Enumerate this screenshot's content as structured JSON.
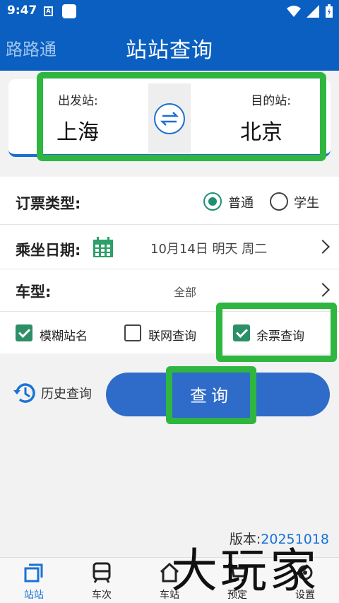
{
  "status_bar": {
    "time": "9:47",
    "notif_icon": "A"
  },
  "app_bar": {
    "app_name": "路路通",
    "title": "站站查询"
  },
  "stations": {
    "from_label": "出发站:",
    "from_value": "上海",
    "to_label": "目的站:",
    "to_value": "北京"
  },
  "ticket_type": {
    "label": "订票类型:",
    "options": [
      {
        "label": "普通",
        "selected": true
      },
      {
        "label": "学生",
        "selected": false
      }
    ]
  },
  "date": {
    "label": "乘坐日期:",
    "value": "10月14日 明天 周二"
  },
  "train_type": {
    "label": "车型:",
    "value": "全部"
  },
  "checks": [
    {
      "label": "模糊站名",
      "checked": true
    },
    {
      "label": "联网查询",
      "checked": false
    },
    {
      "label": "余票查询",
      "checked": true
    }
  ],
  "history": {
    "label": "历史查询"
  },
  "query_button": {
    "label": "查询"
  },
  "version": {
    "label": "版本:",
    "number": "20251018"
  },
  "bottom_nav": [
    {
      "label": "站站",
      "icon": "station-icon",
      "active": true
    },
    {
      "label": "车次",
      "icon": "train-icon",
      "active": false
    },
    {
      "label": "车站",
      "icon": "home-icon",
      "active": false
    },
    {
      "label": "预定",
      "icon": "cart-icon",
      "active": false
    },
    {
      "label": "设置",
      "icon": "gear-icon",
      "active": false
    }
  ],
  "watermark": "大玩家",
  "colors": {
    "primary": "#0a5fc0",
    "accent_green": "#2fb640",
    "check_green": "#2c8f68",
    "button_blue": "#2f6bc9"
  }
}
